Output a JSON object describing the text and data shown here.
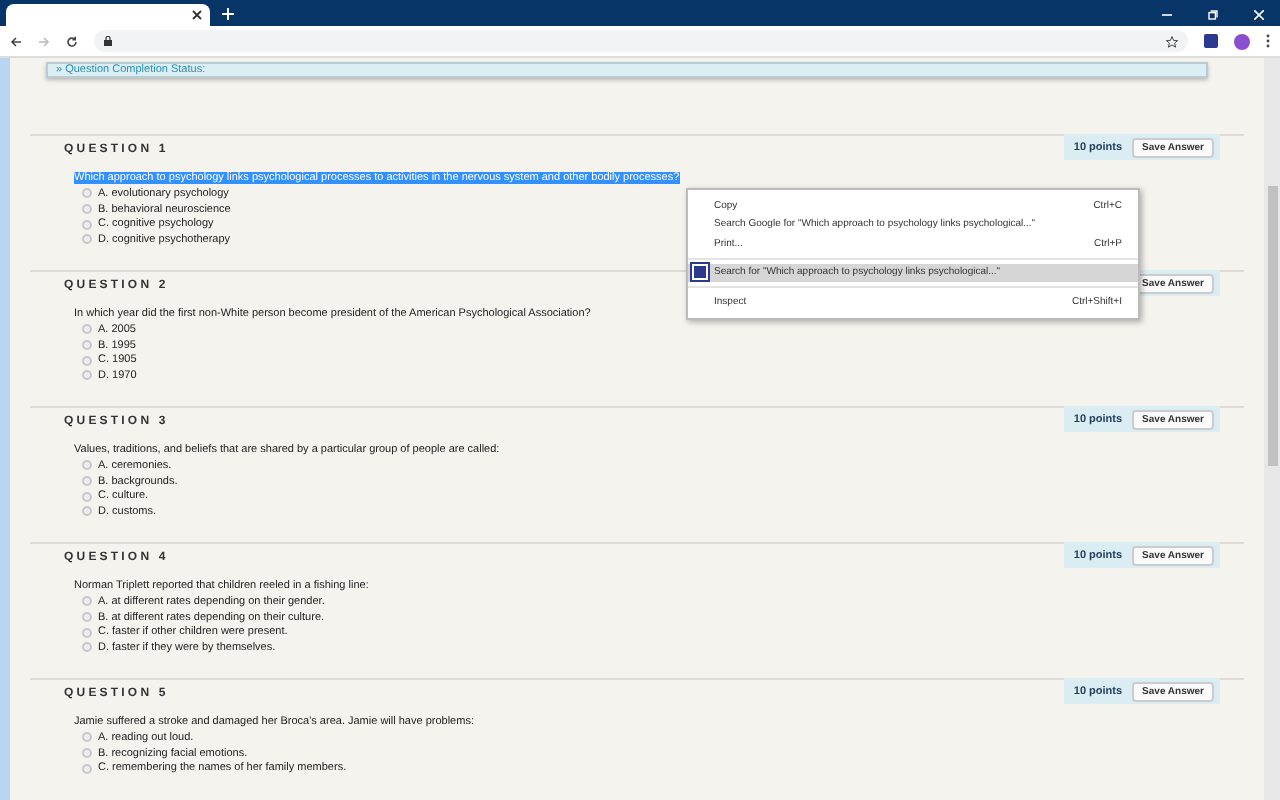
{
  "status_panel": {
    "label": "» Question Completion Status:"
  },
  "questions": [
    {
      "label": "QUESTION 1",
      "points": "10 points",
      "save": "Save Answer",
      "text": "Which approach to psychology links psychological processes to activities in the nervous system and other bodily processes?",
      "text_highlighted": true,
      "options": [
        {
          "label": "A. evolutionary psychology",
          "selected": false
        },
        {
          "label": "B. behavioral neuroscience",
          "selected": false
        },
        {
          "label": "C. cognitive psychology",
          "selected": false
        },
        {
          "label": "D. cognitive psychotherapy",
          "selected": false
        }
      ]
    },
    {
      "label": "QUESTION 2",
      "save": "Save Answer",
      "text": "In which year did the first non-White person become president of the American Psychological Association?",
      "text_highlighted": false,
      "options": [
        {
          "label": "A. 2005",
          "selected": false
        },
        {
          "label": "B. 1995",
          "selected": false
        },
        {
          "label": "C. 1905",
          "selected": false
        },
        {
          "label": "D. 1970",
          "selected": false
        }
      ]
    },
    {
      "label": "QUESTION 3",
      "points": "10 points",
      "save": "Save Answer",
      "text": "Values, traditions, and beliefs that are shared by a particular group of people are called:",
      "text_highlighted": false,
      "options": [
        {
          "label": "A. ceremonies.",
          "selected": false
        },
        {
          "label": "B. backgrounds.",
          "selected": false
        },
        {
          "label": "C. culture.",
          "selected": false
        },
        {
          "label": "D. customs.",
          "selected": false
        }
      ]
    },
    {
      "label": "QUESTION 4",
      "points": "10 points",
      "save": "Save Answer",
      "text": "Norman Triplett reported that children reeled in a fishing line:",
      "text_highlighted": false,
      "options": [
        {
          "label": "A. at different rates depending on their gender.",
          "selected": false
        },
        {
          "label": "B. at different rates depending on their culture.",
          "selected": false
        },
        {
          "label": "C. faster if other children were present.",
          "selected": false
        },
        {
          "label": "D. faster if they were by themselves.",
          "selected": false
        }
      ]
    },
    {
      "label": "QUESTION 5",
      "points": "10 points",
      "save": "Save Answer",
      "text": "Jamie suffered a stroke and damaged her Broca's area. Jamie will have problems:",
      "text_highlighted": false,
      "options": [
        {
          "label": "A. reading out loud.",
          "selected": false
        },
        {
          "label": "B. recognizing facial emotions.",
          "selected": false
        },
        {
          "label": "C. remembering the names of her family members.",
          "selected": false
        }
      ]
    }
  ],
  "context_menu": [
    {
      "kind": "item",
      "label": "Copy",
      "shortcut": "Ctrl+C",
      "selected": false
    },
    {
      "kind": "item",
      "label": "Search Google for \"Which approach to psychology links psychological...\"",
      "selected": false
    },
    {
      "kind": "item",
      "label": "Print...",
      "shortcut": "Ctrl+P",
      "selected": false
    },
    {
      "kind": "separator"
    },
    {
      "kind": "extension",
      "label": "Search for \"Which approach to psychology links psychological...\"",
      "selected": true
    },
    {
      "kind": "separator"
    },
    {
      "kind": "item",
      "label": "Inspect",
      "shortcut": "Ctrl+Shift+I",
      "selected": false
    }
  ]
}
